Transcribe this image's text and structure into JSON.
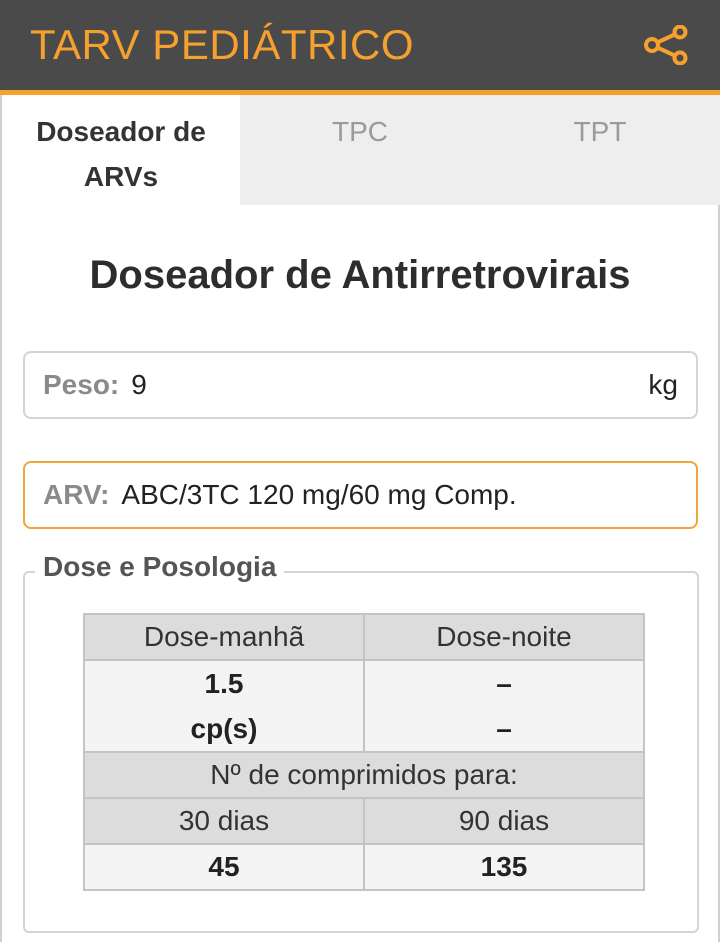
{
  "appbar": {
    "title": "TARV PEDIÁTRICO",
    "share_icon": "share-icon",
    "accent": "#f6a02d",
    "background": "#4a4a4a"
  },
  "tabs": [
    {
      "label_line1": "Doseador de",
      "label_line2": "ARVs",
      "active": true
    },
    {
      "label": "TPC",
      "active": false
    },
    {
      "label": "TPT",
      "active": false
    }
  ],
  "main": {
    "title": "Doseador de Antirretrovirais",
    "peso": {
      "label": "Peso:",
      "value": "9",
      "unit": "kg"
    },
    "arv": {
      "label": "ARV:",
      "value": "ABC/3TC 120 mg/60 mg Comp."
    },
    "dose_section": {
      "legend": "Dose e Posologia",
      "headers": [
        "Dose-manhã",
        "Dose-noite"
      ],
      "morning_value": "1.5",
      "morning_unit": "cp(s)",
      "night_value": "–",
      "night_unit": "–",
      "count_label": "Nº de comprimidos para:",
      "periods": [
        "30 dias",
        "90 dias"
      ],
      "counts": [
        "45",
        "135"
      ]
    }
  }
}
